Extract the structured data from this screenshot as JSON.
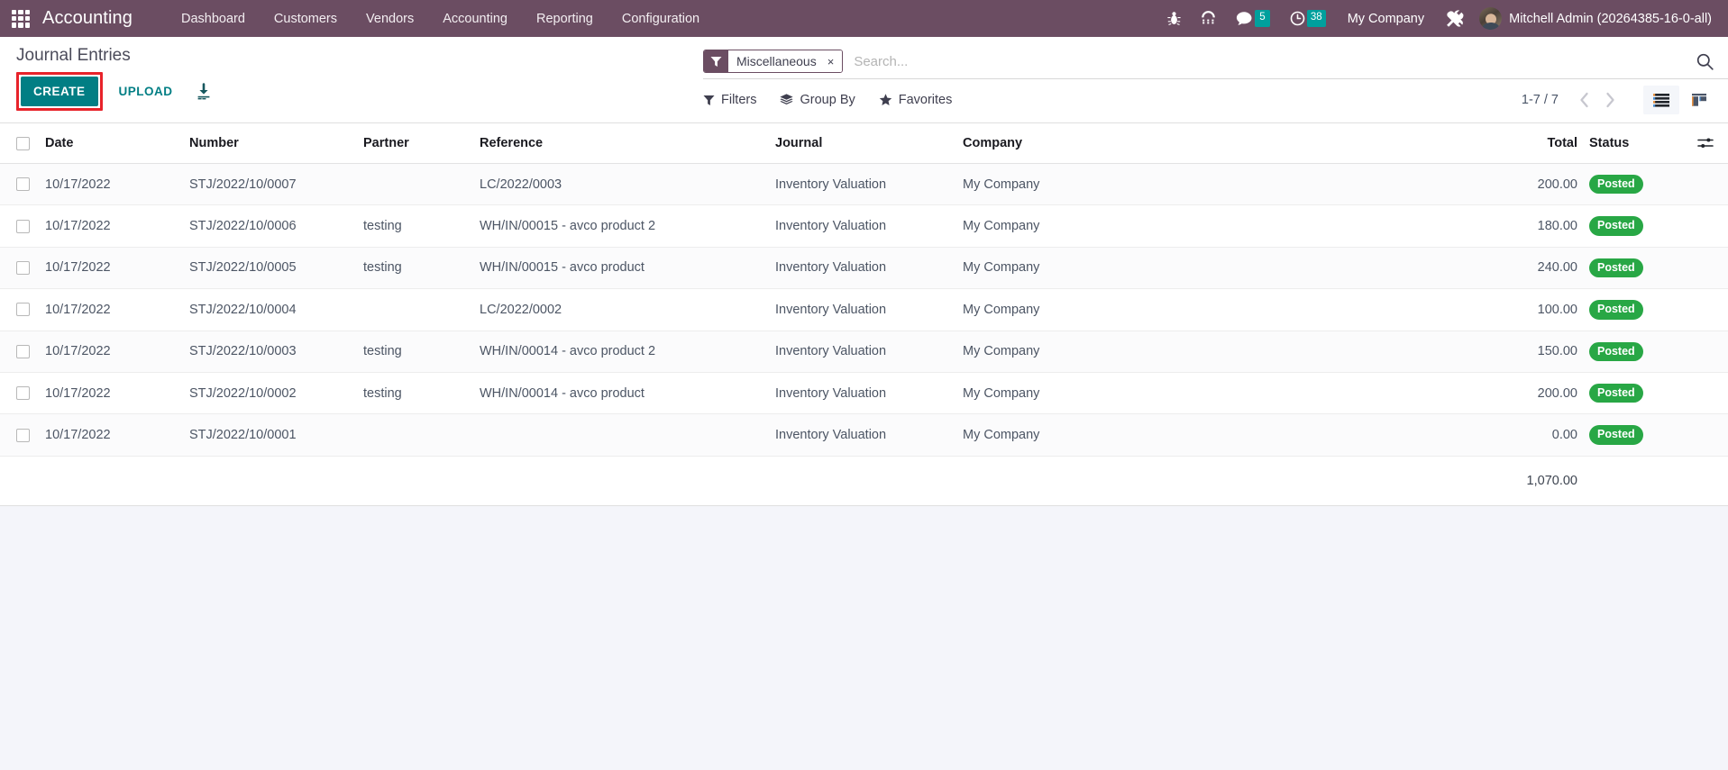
{
  "navbar": {
    "apps_icon": "apps-grid-icon",
    "brand": "Accounting",
    "menu": [
      {
        "label": "Dashboard"
      },
      {
        "label": "Customers"
      },
      {
        "label": "Vendors"
      },
      {
        "label": "Accounting"
      },
      {
        "label": "Reporting"
      },
      {
        "label": "Configuration"
      }
    ],
    "icons": {
      "debug": "bug-icon",
      "dialpad": "dialpad-icon",
      "messages": "chat-bubble-icon",
      "activities": "clock-icon",
      "tools": "tools-icon"
    },
    "messages_count": "5",
    "activities_count": "38",
    "company": "My Company",
    "user_name": "Mitchell Admin (20264385-16-0-all)",
    "bg_color": "#6b4d62"
  },
  "control_panel": {
    "breadcrumb": "Journal Entries",
    "create_label": "CREATE",
    "upload_label": "UPLOAD",
    "download_icon": "download-icon",
    "create_highlight_color": "#e8232a",
    "create_bg_color": "#017e84"
  },
  "search": {
    "facet_label": "Miscellaneous",
    "facet_close": "×",
    "facet_icon": "filter-icon",
    "placeholder": "Search...",
    "value": "",
    "magnifier_icon": "search-icon"
  },
  "filters": {
    "filters_label": "Filters",
    "group_by_label": "Group By",
    "favorites_label": "Favorites"
  },
  "pager": {
    "range": "1-7 / 7",
    "prev_icon": "chevron-left-icon",
    "next_icon": "chevron-right-icon",
    "list_view_icon": "list-view-icon",
    "kanban_view_icon": "kanban-view-icon",
    "active_view": "list"
  },
  "table": {
    "columns": [
      {
        "key": "date",
        "label": "Date"
      },
      {
        "key": "number",
        "label": "Number"
      },
      {
        "key": "partner",
        "label": "Partner"
      },
      {
        "key": "reference",
        "label": "Reference"
      },
      {
        "key": "journal",
        "label": "Journal"
      },
      {
        "key": "company",
        "label": "Company"
      },
      {
        "key": "total",
        "label": "Total"
      },
      {
        "key": "status",
        "label": "Status"
      }
    ],
    "optional_columns_icon": "column-settings-icon",
    "rows": [
      {
        "date": "10/17/2022",
        "number": "STJ/2022/10/0007",
        "partner": "",
        "reference": "LC/2022/0003",
        "journal": "Inventory Valuation",
        "company": "My Company",
        "total": "200.00",
        "status": "Posted"
      },
      {
        "date": "10/17/2022",
        "number": "STJ/2022/10/0006",
        "partner": "testing",
        "reference": "WH/IN/00015 - avco product 2",
        "journal": "Inventory Valuation",
        "company": "My Company",
        "total": "180.00",
        "status": "Posted"
      },
      {
        "date": "10/17/2022",
        "number": "STJ/2022/10/0005",
        "partner": "testing",
        "reference": "WH/IN/00015 - avco product",
        "journal": "Inventory Valuation",
        "company": "My Company",
        "total": "240.00",
        "status": "Posted"
      },
      {
        "date": "10/17/2022",
        "number": "STJ/2022/10/0004",
        "partner": "",
        "reference": "LC/2022/0002",
        "journal": "Inventory Valuation",
        "company": "My Company",
        "total": "100.00",
        "status": "Posted"
      },
      {
        "date": "10/17/2022",
        "number": "STJ/2022/10/0003",
        "partner": "testing",
        "reference": "WH/IN/00014 - avco product 2",
        "journal": "Inventory Valuation",
        "company": "My Company",
        "total": "150.00",
        "status": "Posted"
      },
      {
        "date": "10/17/2022",
        "number": "STJ/2022/10/0002",
        "partner": "testing",
        "reference": "WH/IN/00014 - avco product",
        "journal": "Inventory Valuation",
        "company": "My Company",
        "total": "200.00",
        "status": "Posted"
      },
      {
        "date": "10/17/2022",
        "number": "STJ/2022/10/0001",
        "partner": "",
        "reference": "",
        "journal": "Inventory Valuation",
        "company": "My Company",
        "total": "0.00",
        "status": "Posted"
      }
    ],
    "total_sum": "1,070.00",
    "status_badge_color": "#28a745"
  }
}
